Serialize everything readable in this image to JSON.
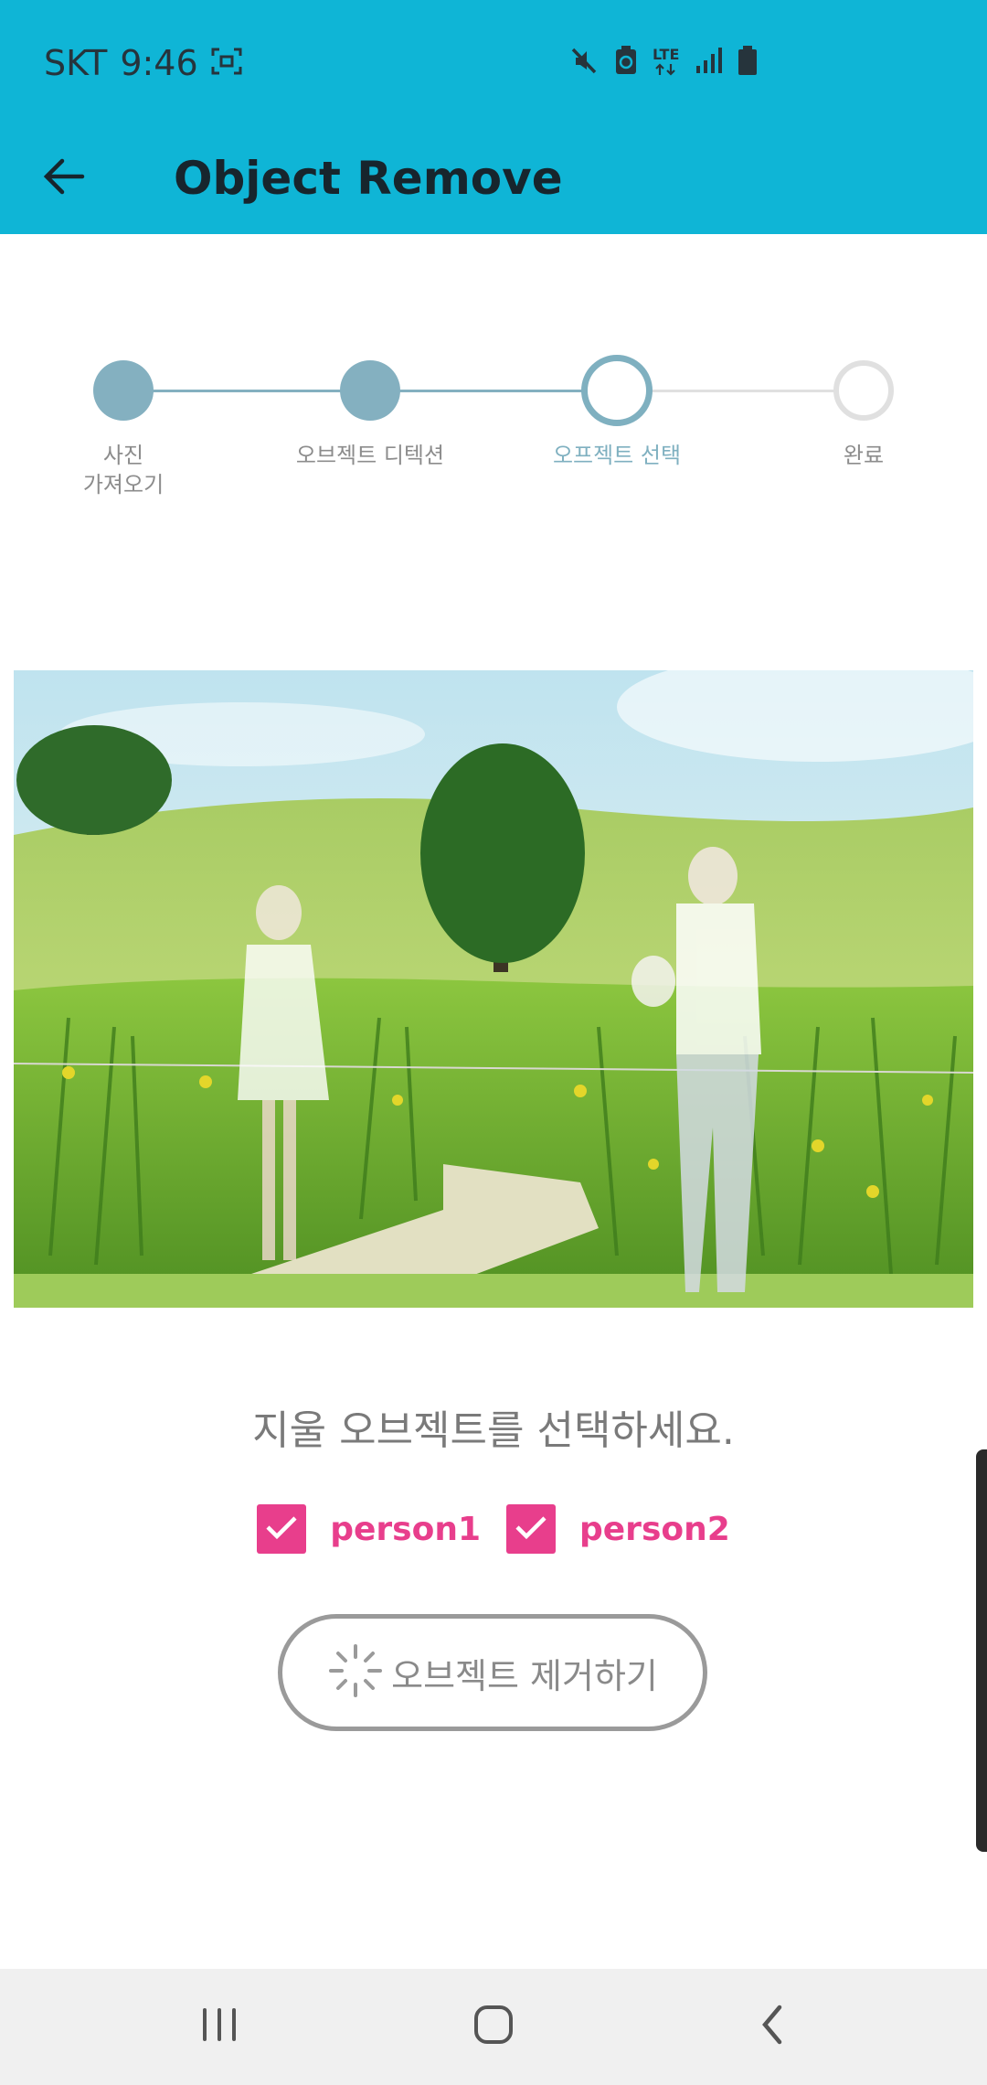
{
  "status_bar": {
    "carrier": "SKT",
    "time": "9:46",
    "network": "LTE",
    "icons": [
      "screenshot-icon",
      "mute-icon",
      "battery-saver-icon",
      "lte-icon",
      "signal-icon",
      "battery-icon"
    ]
  },
  "app_bar": {
    "title": "Object Remove",
    "back_icon": "arrow-left-icon"
  },
  "stepper": {
    "steps": [
      {
        "label": "사진\n가져오기",
        "state": "done"
      },
      {
        "label": "오브젝트 디텍션",
        "state": "done"
      },
      {
        "label": "오프젝트 선택",
        "state": "current"
      },
      {
        "label": "완료",
        "state": "pending"
      }
    ],
    "colors": {
      "done": "#84b0c0",
      "current": "#7fb0c0",
      "pending": "#e0e0e0",
      "current_label": "#7fb0c0"
    }
  },
  "photo": {
    "description_icon": "photo-couple-field"
  },
  "instruction": "지울 오브젝트를 선택하세요.",
  "objects": [
    {
      "label": "person1",
      "checked": true
    },
    {
      "label": "person2",
      "checked": true
    }
  ],
  "remove_button": {
    "label": "오브젝트 제거하기",
    "icon": "spinner-icon"
  },
  "nav_bar": {
    "icons": [
      "recent-apps-icon",
      "home-icon",
      "back-icon"
    ]
  },
  "colors": {
    "accent": "#0fb5d6",
    "check": "#e83e8c"
  }
}
